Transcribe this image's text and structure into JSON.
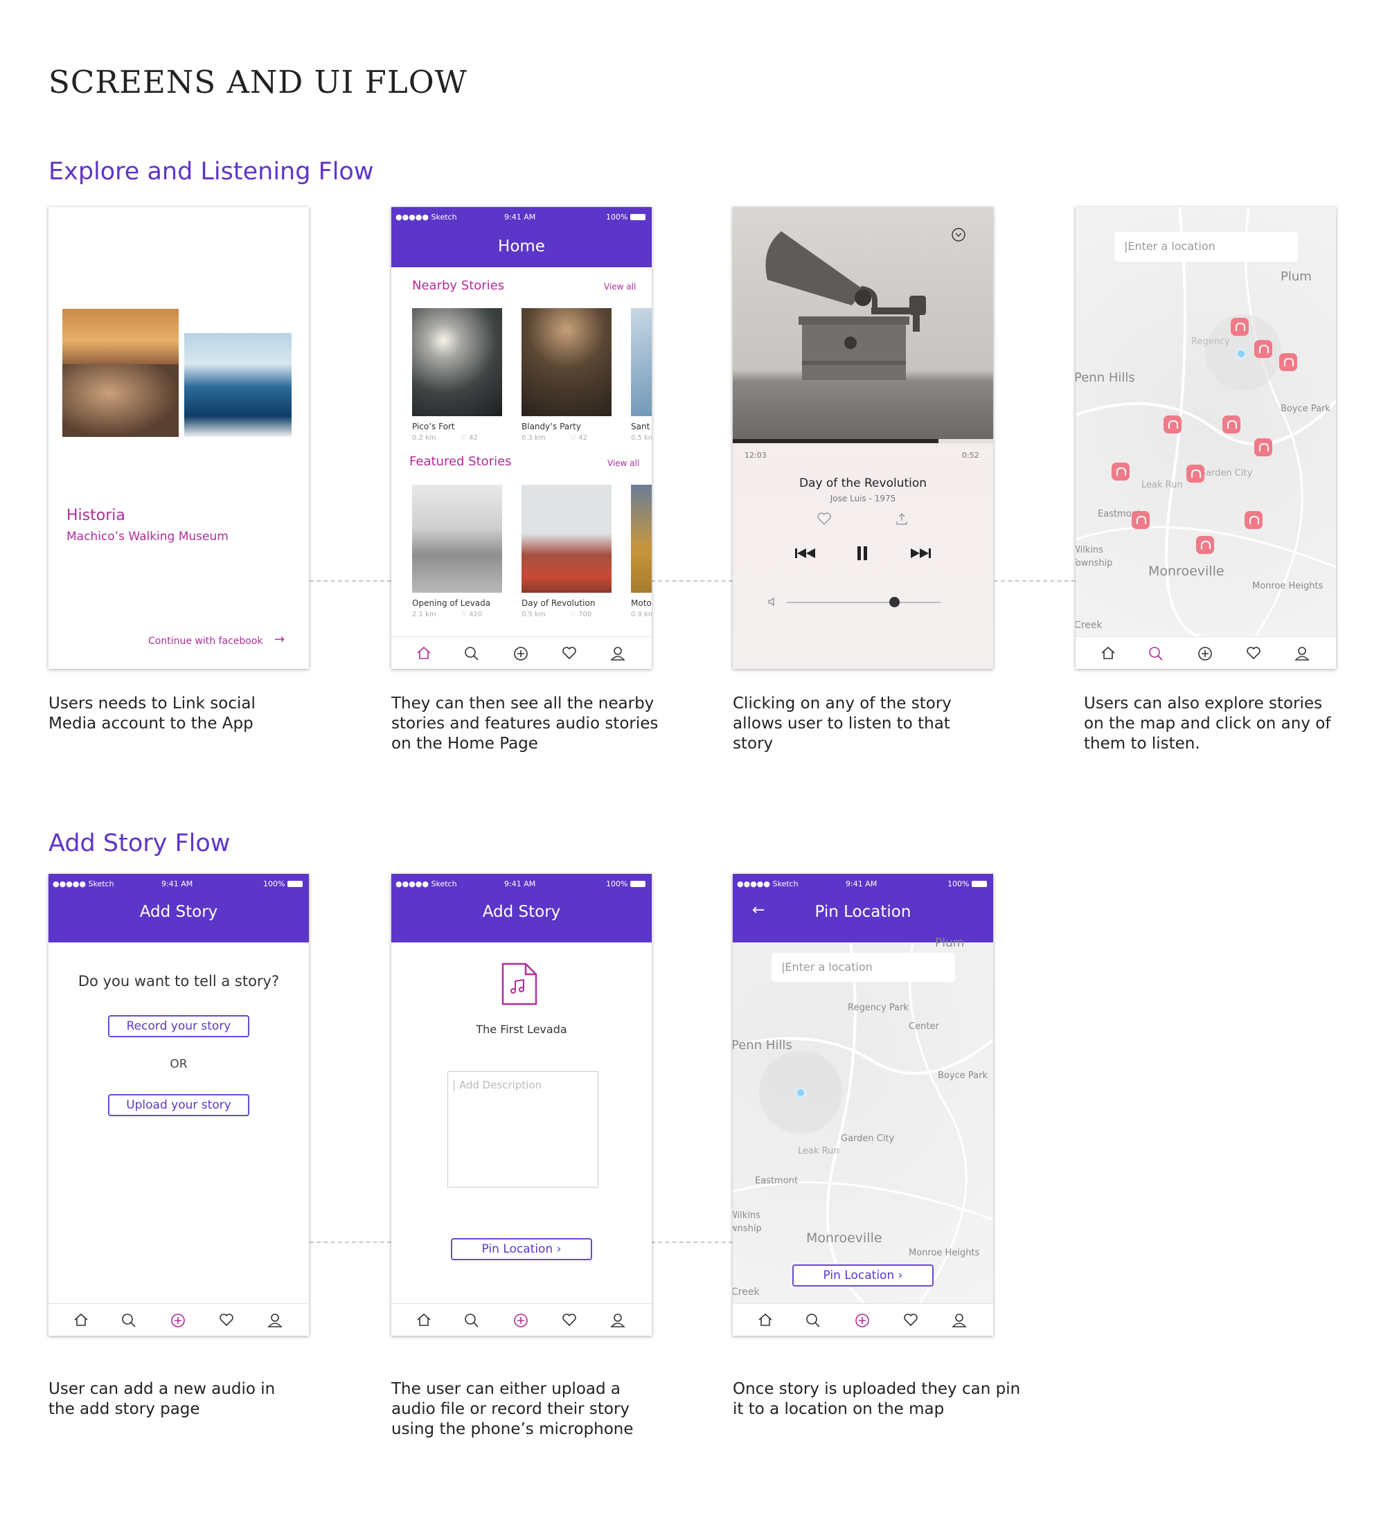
{
  "page_title": "SCREENS AND UI FLOW",
  "section1": {
    "title": "Explore and Listening Flow",
    "captions": [
      "Users needs to Link social Media account to the App",
      "They can then see all the nearby stories and features audio stories on the Home Page",
      "Clicking on any of the story allows user to listen to that story",
      "Users can also explore stories on the map and click on any of them to listen."
    ]
  },
  "section2": {
    "title": "Add Story Flow",
    "captions": [
      "User can add a new audio in the add story page",
      "The user can either upload a audio file or record their story using the phone’s microphone",
      "Once story is uploaded they can pin it to a location on the map"
    ]
  },
  "status": {
    "carrier": "●●●●● Sketch",
    "time": "9:41 AM",
    "battery": "100%"
  },
  "login": {
    "app_name": "Historia",
    "subtitle": "Machico’s Walking Museum",
    "cta": "Continue with facebook",
    "arrow": "→"
  },
  "home": {
    "title": "Home",
    "nearby_title": "Nearby Stories",
    "featured_title": "Featured Stories",
    "view_all": "View all",
    "nearby": [
      {
        "name": "Pico’s Fort",
        "dist": "0.2 km",
        "likes": "♡ 42"
      },
      {
        "name": "Blandy’s Party",
        "dist": "0.3 km",
        "likes": "♡ 42"
      },
      {
        "name": "Sant",
        "dist": "0.5 km",
        "likes": ""
      }
    ],
    "featured": [
      {
        "name": "Opening of Levada",
        "dist": "2.1 km",
        "likes": "♡ 420"
      },
      {
        "name": "Day of Revolution",
        "dist": "0.5 km",
        "likes": "♡ 700"
      },
      {
        "name": "Moto",
        "dist": "0.9 km",
        "likes": ""
      }
    ]
  },
  "player": {
    "elapsed": "12:03",
    "remaining": "0:52",
    "title": "Day of the Revolution",
    "artist": "Jose Luis - 1975",
    "progress": 0.79,
    "volume": 0.7
  },
  "map": {
    "search_placeholder": "|Enter a location",
    "labels": [
      "Plum",
      "Regency",
      "Penn Hills",
      "Boyce Park",
      "Leak Run",
      "Garden City",
      "Eastmont",
      "Wilkins Township",
      "Monroeville",
      "Monroe Heights",
      "Creek"
    ]
  },
  "add_story": {
    "title": "Add Story",
    "question": "Do you want to tell  a story?",
    "record": "Record your story",
    "or": "OR",
    "upload": "Upload your story"
  },
  "add_story2": {
    "title": "Add Story",
    "file_name": "The First Levada",
    "description_placeholder": "| Add Description",
    "pin_btn": "Pin Location  ›"
  },
  "pin_location": {
    "title": "Pin Location",
    "back": "←",
    "search_placeholder": "|Enter a location",
    "labels": [
      "Plum",
      "Regency Park",
      "Center",
      "Penn Hills",
      "Boyce Park",
      "Garden City",
      "Leak Run",
      "Eastmont",
      "Wilkins",
      "wnship",
      "Monroeville",
      "Monroe Heights",
      "Creek"
    ],
    "pin_btn": "Pin Location  ›"
  },
  "colors": {
    "brand_purple": "#5c36c8",
    "accent_magenta": "#b02d9c",
    "pin_pink": "#f07a88"
  }
}
